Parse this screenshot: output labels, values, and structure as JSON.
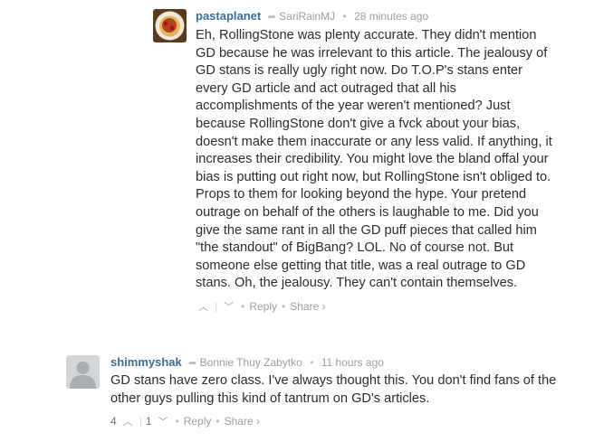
{
  "comments": [
    {
      "author": "pastaplanet",
      "in_reply_to": "SariRainMJ",
      "time": "28 minutes ago",
      "text": "Eh, RollingStone was plenty accurate. They didn't mention GD because he was irrelevant to this article. The jealousy of GD stans is really ugly right now. Do T.O.P's stans enter every GD article and act outraged that all his accomplishments of the year weren't mentioned? Just because RollingStone don't give a fvck about your bias, doesn't make them inaccurate or any less valid. If anything, it increases their credibility. You might love the bland offal your bias is putting out right now, but RollingStone isn't obliged to. Props to them for looking beyond the hype. Your pretend outrage on behalf of the others is laughable to me. Did you give the same rant in all the GD puff pieces that called him \"the standout\" of BigBang? LOL. No of course not. But someone else getting that title, was a real outrage to GD stans. Oh, the jealousy. They can't contain themselves.",
      "upvotes": "",
      "downvotes": "",
      "reply_label": "Reply",
      "share_label": "Share ›",
      "avatar_icon": "food-plate-avatar"
    },
    {
      "author": "shimmyshak",
      "in_reply_to": "Bonnie Thuy Zabytko",
      "time": "11 hours ago",
      "text": "GD stans have zero class. I've always thought this. You don't find fans of the other guys pulling this kind of tantrum on GD's articles.",
      "upvotes": "4",
      "downvotes": "1",
      "reply_label": "Reply",
      "share_label": "Share ›",
      "avatar_icon": "default-user-avatar"
    }
  ],
  "icons": {
    "reply_arrow": "➦",
    "upvote": "︿",
    "downvote": "﹀",
    "dot": "•",
    "separator": "|"
  },
  "colors": {
    "author": "#3a6d99",
    "meta": "#9aa0a3",
    "text": "#2a2e2e"
  }
}
